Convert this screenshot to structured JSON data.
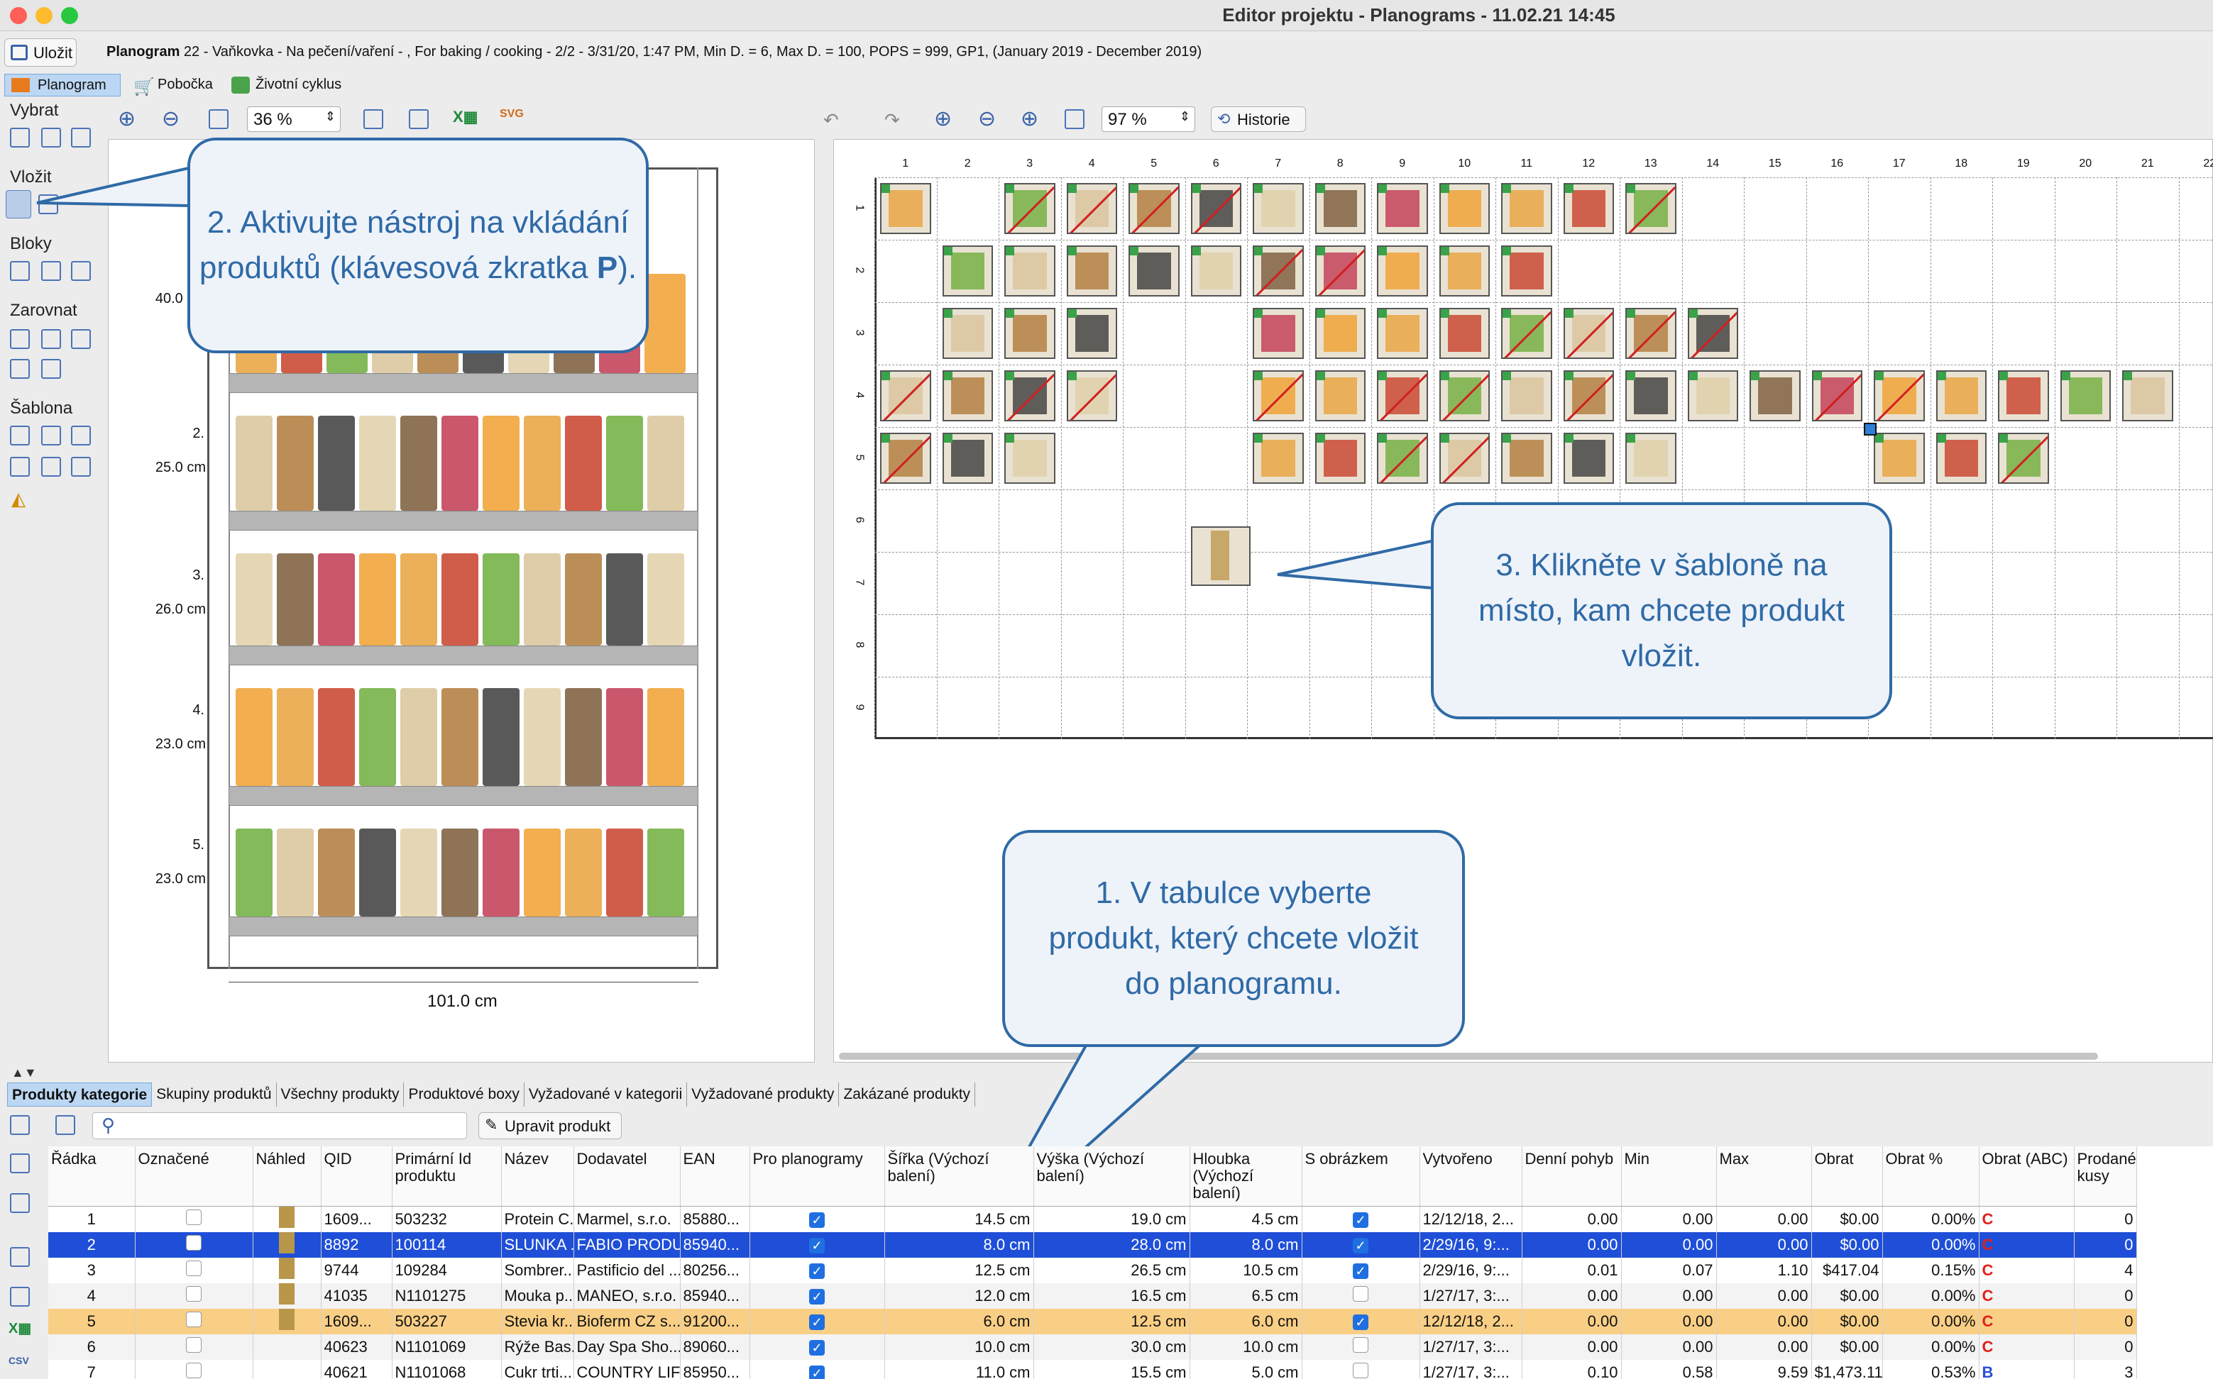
{
  "window": {
    "title": "Editor projektu - Planograms - 11.02.21 14:45"
  },
  "header": {
    "save_label": "Uložit",
    "planogram_label": "Planogram",
    "planogram_info": "22 - Vaňkovka - Na pečení/vaření - , For baking / cooking - 2/2 - 3/31/20, 1:47 PM, Min D. = 6, Max D. = 100, POPS = 999, GP1, (January 2019 - December 2019)"
  },
  "top_tabs": [
    "Planogram",
    "Pobočka",
    "Životní cyklus"
  ],
  "left_tools": {
    "vybrat": "Vybrat",
    "vlozit": "Vložit",
    "bloky": "Bloky",
    "zarovnat": "Zarovnat",
    "sablona": "Šablona"
  },
  "left_toolbar": {
    "zoom": "36 %"
  },
  "right_toolbar": {
    "zoom": "97 %",
    "history": "Historie"
  },
  "shelves": [
    {
      "label": "1.",
      "height": "40.0 cm"
    },
    {
      "label": "2.",
      "height": "25.0 cm"
    },
    {
      "label": "3.",
      "height": "26.0 cm"
    },
    {
      "label": "4.",
      "height": "23.0 cm"
    },
    {
      "label": "5.",
      "height": "23.0 cm"
    }
  ],
  "shelf_width": "101.0 cm",
  "grid": {
    "cols": [
      "1",
      "2",
      "3",
      "4",
      "5",
      "6",
      "7",
      "8",
      "9",
      "10",
      "11",
      "12",
      "13",
      "14",
      "15",
      "16",
      "17",
      "18",
      "19",
      "20",
      "21",
      "22"
    ],
    "rows": [
      "1",
      "2",
      "3",
      "4",
      "5",
      "6",
      "7",
      "8",
      "9"
    ]
  },
  "callouts": {
    "c1": "1. V tabulce vyberte produkt, který chcete vložit do planogramu.",
    "c2a": "2. Aktivujte nástroj na vkládání produktů (klávesová zkratka ",
    "c2b": "P",
    "c2c": ").",
    "c3": "3. Klikněte v šabloně na místo, kam chcete produkt vložit."
  },
  "bottom_tabs": [
    "Produkty kategorie",
    "Skupiny produktů",
    "Všechny produkty",
    "Produktové boxy",
    "Vyžadované v kategorii",
    "Vyžadované produkty",
    "Zakázané produkty"
  ],
  "edit_button": "Upravit produkt",
  "columns": [
    "Řádka",
    "Označené",
    "Náhled",
    "QID",
    "Primární Id produktu",
    "Název",
    "Dodavatel",
    "EAN",
    "Pro planogramy",
    "Šířka (Výchozí balení)",
    "Výška (Výchozí balení)",
    "Hloubka (Výchozí balení)",
    "S obrázkem",
    "Vytvořeno",
    "Denní pohyb",
    "Min",
    "Max",
    "Obrat",
    "Obrat %",
    "Obrat (ABC)",
    "Prodané kusy"
  ],
  "rows": [
    [
      "1",
      "",
      "",
      "1609...",
      "503232",
      "Protein C...",
      "Marmel, s.r.o.",
      "85880...",
      "✓",
      "14.5 cm",
      "19.0 cm",
      "4.5 cm",
      "✓",
      "12/12/18, 2...",
      "0.00",
      "0.00",
      "0.00",
      "$0.00",
      "0.00%",
      "C",
      "0"
    ],
    [
      "2",
      "",
      "",
      "8892",
      "100114",
      "SLUNKA ...",
      "FABIO PRODU...",
      "85940...",
      "✓",
      "8.0 cm",
      "28.0 cm",
      "8.0 cm",
      "✓",
      "2/29/16, 9:...",
      "0.00",
      "0.00",
      "0.00",
      "$0.00",
      "0.00%",
      "C",
      "0"
    ],
    [
      "3",
      "",
      "",
      "9744",
      "109284",
      "Sombrer...",
      "Pastificio del ...",
      "80256...",
      "✓",
      "12.5 cm",
      "26.5 cm",
      "10.5 cm",
      "✓",
      "2/29/16, 9:...",
      "0.01",
      "0.07",
      "1.10",
      "$417.04",
      "0.15%",
      "C",
      "4"
    ],
    [
      "4",
      "",
      "",
      "41035",
      "N1101275",
      "Mouka p...",
      "MANEO, s.r.o.",
      "85940...",
      "✓",
      "12.0 cm",
      "16.5 cm",
      "6.5 cm",
      "",
      "1/27/17, 3:...",
      "0.00",
      "0.00",
      "0.00",
      "$0.00",
      "0.00%",
      "C",
      "0"
    ],
    [
      "5",
      "",
      "",
      "1609...",
      "503227",
      "Stevia kr...",
      "Bioferm CZ s...",
      "91200...",
      "✓",
      "6.0 cm",
      "12.5 cm",
      "6.0 cm",
      "✓",
      "12/12/18, 2...",
      "0.00",
      "0.00",
      "0.00",
      "$0.00",
      "0.00%",
      "C",
      "0"
    ],
    [
      "6",
      "",
      "",
      "40623",
      "N1101069",
      "Rýže Bas...",
      "Day Spa Sho...",
      "89060...",
      "✓",
      "10.0 cm",
      "30.0 cm",
      "10.0 cm",
      "",
      "1/27/17, 3:...",
      "0.00",
      "0.00",
      "0.00",
      "$0.00",
      "0.00%",
      "C",
      "0"
    ],
    [
      "7",
      "",
      "",
      "40621",
      "N1101068",
      "Cukr trti...",
      "COUNTRY LIF...",
      "85950...",
      "✓",
      "11.0 cm",
      "15.5 cm",
      "5.0 cm",
      "",
      "1/27/17, 3:...",
      "0.10",
      "0.58",
      "9.59",
      "$1,473.11",
      "0.53%",
      "B",
      "3"
    ]
  ],
  "colors": {
    "accent": "#2f6aa6",
    "selected_row": "#1f4fd8",
    "highlight_row": "#f9cf86",
    "check": "#1f6fe0",
    "abc_c": "#e0201b"
  }
}
